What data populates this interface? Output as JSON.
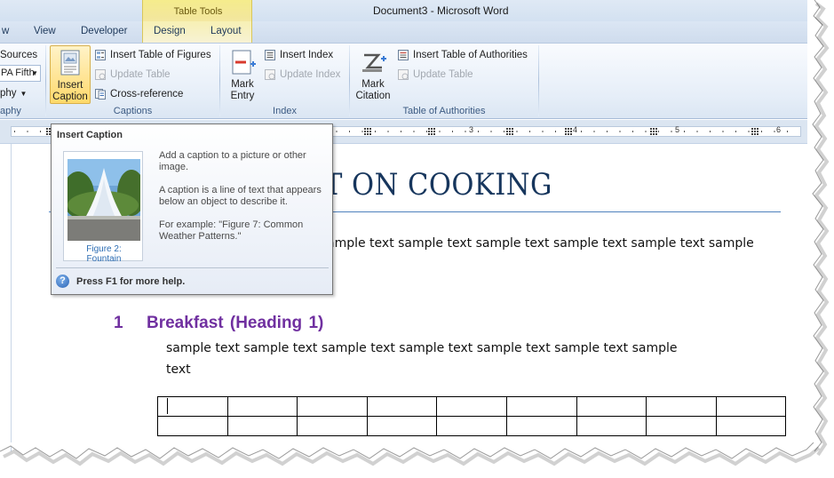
{
  "window": {
    "title": "Document3 - Microsoft Word"
  },
  "context_tab": {
    "label": "Table Tools"
  },
  "tabs": [
    "w",
    "View",
    "Developer",
    "Design",
    "Layout"
  ],
  "ribbon": {
    "citations": {
      "sources_label": "Sources",
      "style_value": "PA Fifth",
      "bibliography_label": "phy",
      "group_label": "aphy"
    },
    "captions": {
      "insert_caption_label": "Insert Caption",
      "insert_table_of_figures": "Insert Table of Figures",
      "update_table": "Update Table",
      "cross_reference": "Cross-reference",
      "group_label": "Captions"
    },
    "index": {
      "mark_entry_label": "Mark Entry",
      "insert_index": "Insert Index",
      "update_index": "Update Index",
      "group_label": "Index"
    },
    "authorities": {
      "mark_citation_label": "Mark Citation",
      "insert_table_of_authorities": "Insert Table of Authorities",
      "update_table": "Update Table",
      "group_label": "Table of Authorities"
    }
  },
  "ruler": {
    "marks": [
      "3",
      "4",
      "5",
      "6"
    ]
  },
  "document": {
    "title_visible": "T ON COOKING",
    "para1_line1": "ample text sample text sample text sample text sample text sample",
    "heading_number": "1",
    "heading_text": "Breakfast (Heading 1)",
    "para2_line1": "sample text sample text sample text sample text sample text sample text sample",
    "para2_line2": "text",
    "table": {
      "rows": 2,
      "cols": 9
    }
  },
  "tooltip": {
    "title": "Insert Caption",
    "image_caption": "Figure 2: Fountain",
    "desc1": "Add a caption to a picture or other image.",
    "desc2": "A caption is a line of text that appears below an object to describe it.",
    "desc3": "For example: \"Figure 7: Common Weather Patterns.\"",
    "help_text": "Press F1 for more help."
  },
  "colors": {
    "heading": "#7030a0",
    "title": "#17365d",
    "title_rule": "#4f81bd",
    "context_tab": "#f3e79b"
  }
}
